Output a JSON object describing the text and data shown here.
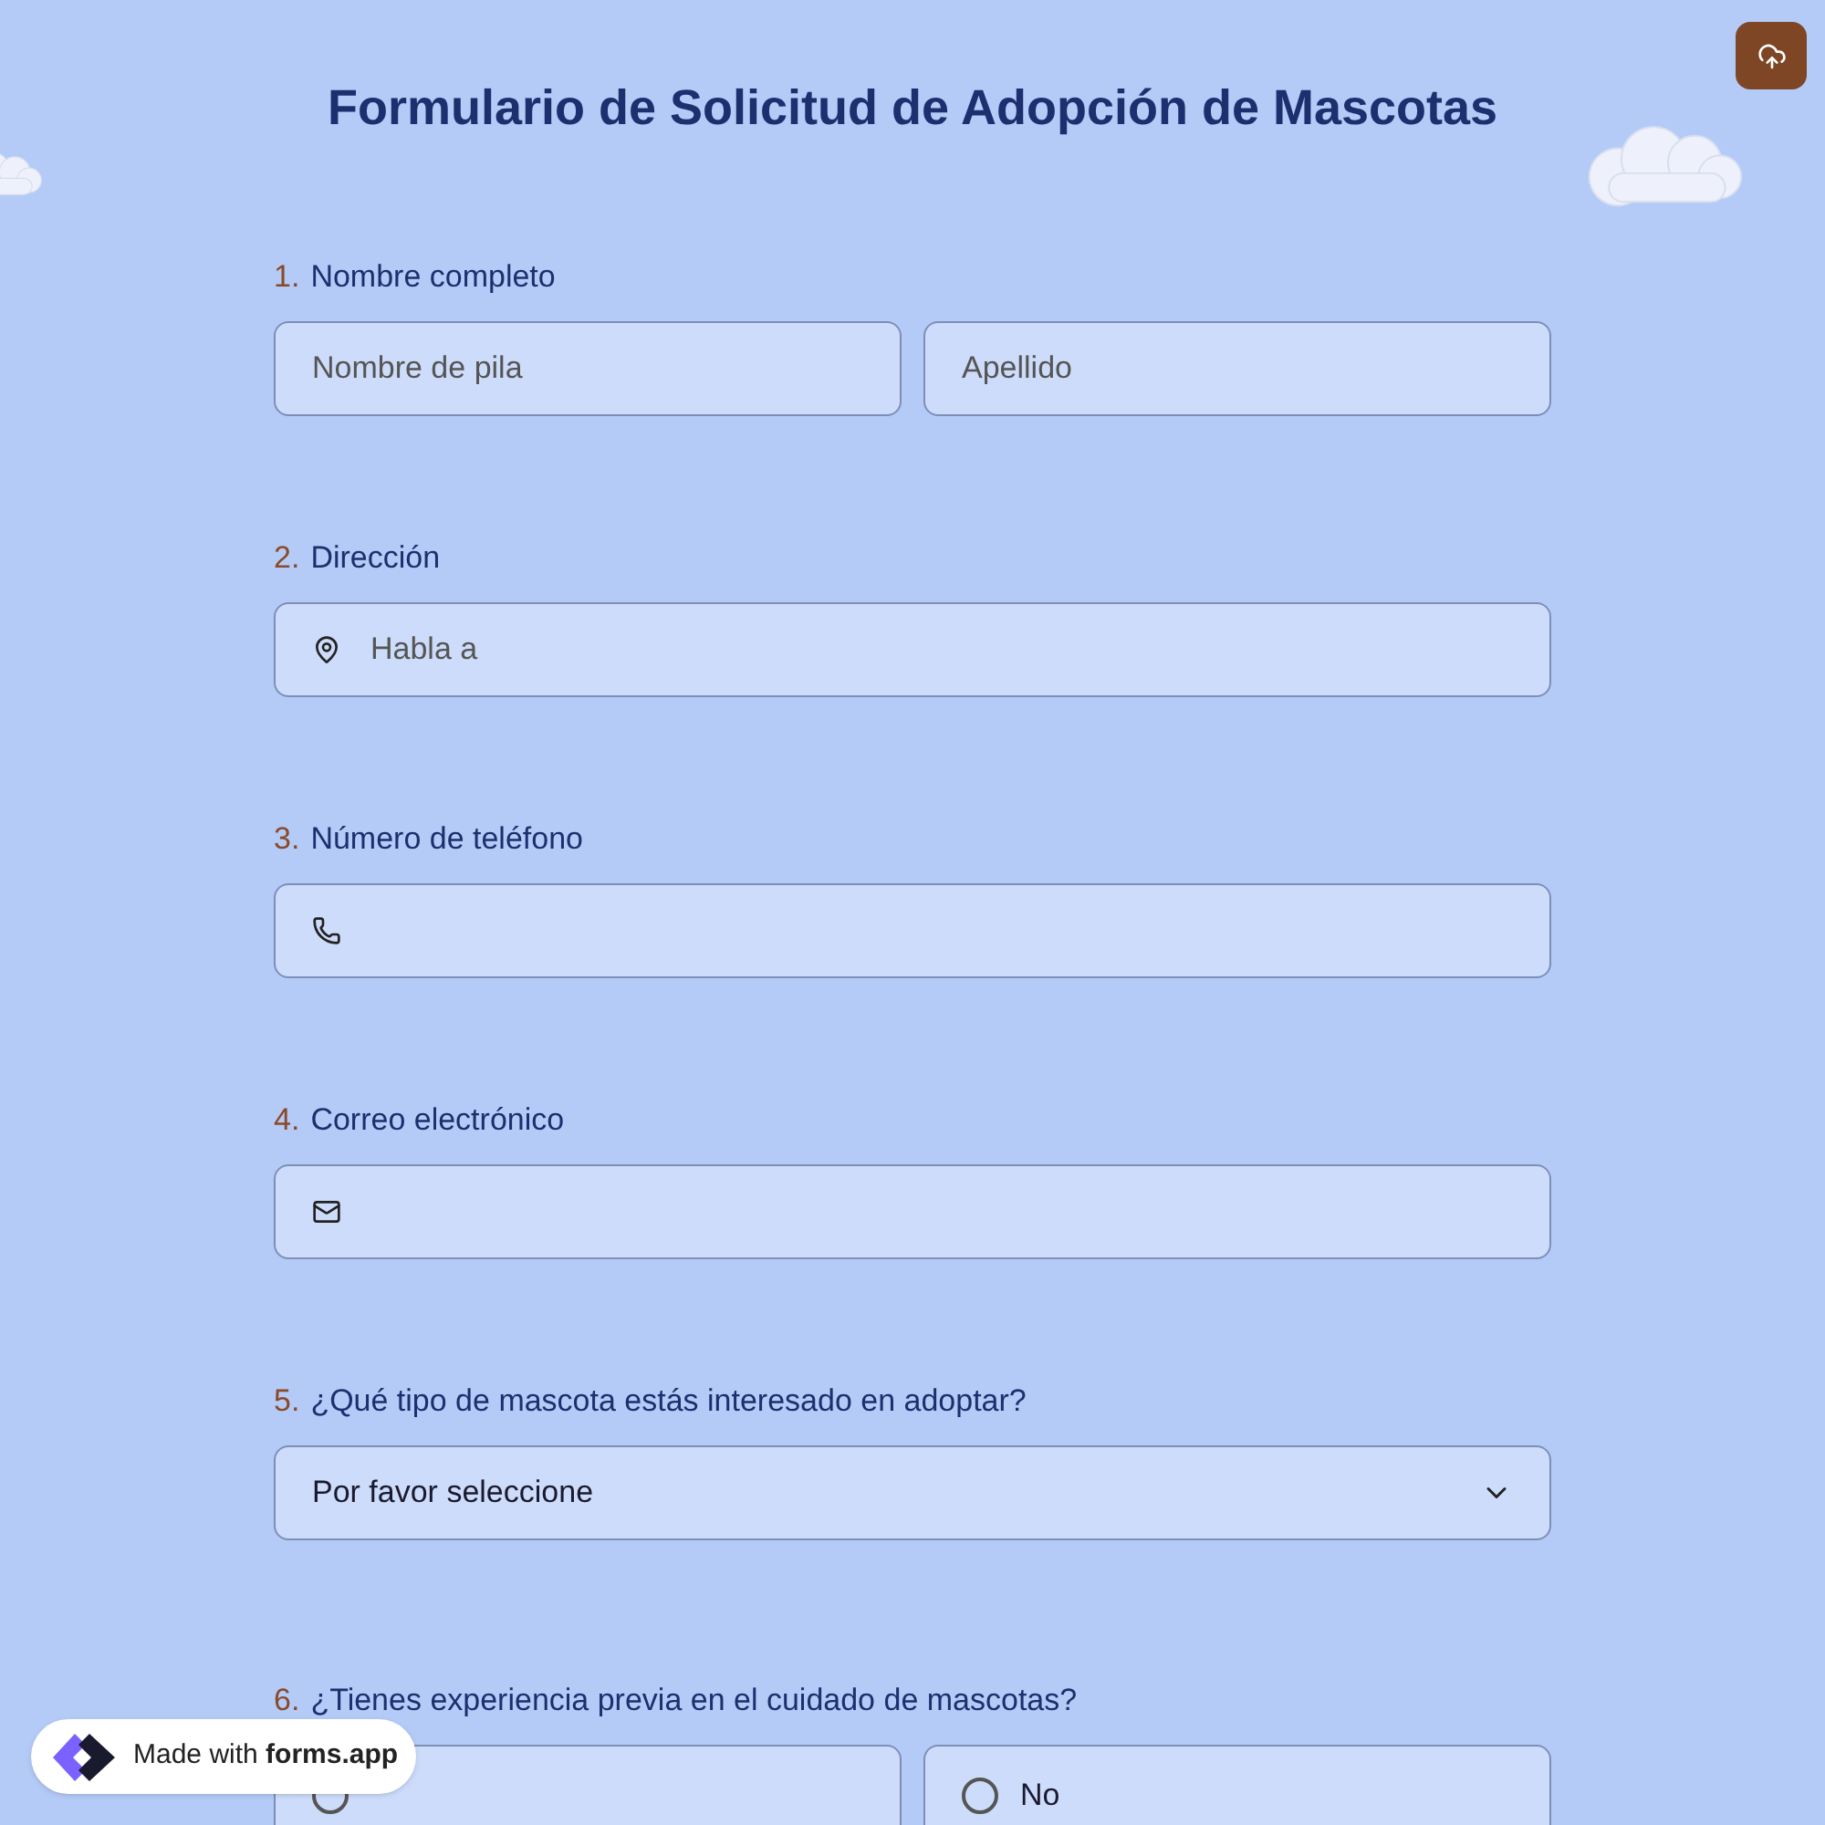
{
  "title": "Formulario de Solicitud de Adopción de Mascotas",
  "questions": [
    {
      "number": "1.",
      "label": "Nombre completo",
      "kind": "name",
      "fields": [
        {
          "placeholder": "Nombre de pila"
        },
        {
          "placeholder": "Apellido"
        }
      ]
    },
    {
      "number": "2.",
      "label": "Dirección",
      "kind": "text",
      "placeholder": "Habla a"
    },
    {
      "number": "3.",
      "label": "Número de teléfono",
      "kind": "text"
    },
    {
      "number": "4.",
      "label": "Correo electrónico",
      "kind": "text"
    },
    {
      "number": "5.",
      "label": "¿Qué tipo de mascota estás interesado en adoptar?",
      "kind": "select",
      "value": "Por favor seleccione"
    },
    {
      "number": "6.",
      "label": "¿Tienes experiencia previa en el cuidado de mascotas?",
      "kind": "radio",
      "options": [
        {
          "selected": false
        },
        {
          "label": "No",
          "selected": false
        }
      ]
    }
  ],
  "badge": {
    "prefix": "Made with",
    "brand": "forms.app"
  }
}
